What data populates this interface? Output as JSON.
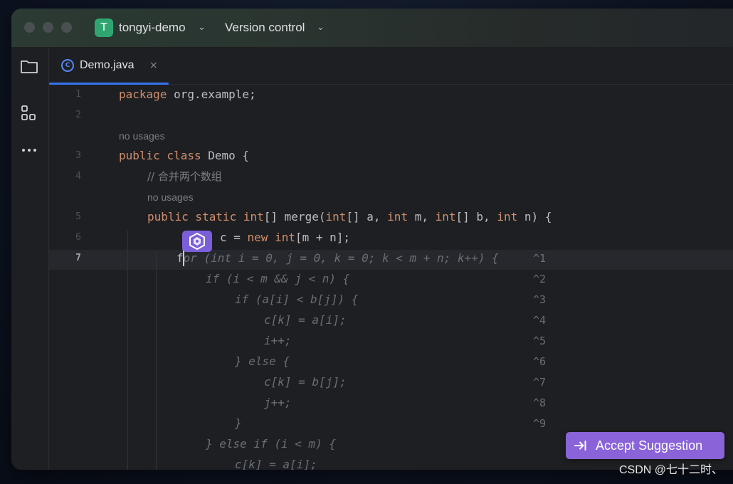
{
  "titlebar": {
    "project_initial": "T",
    "project_name": "tongyi-demo",
    "vcs_label": "Version control",
    "project_color": "#2fa672"
  },
  "sidebar": {
    "icons": [
      "folder-icon",
      "structure-icon",
      "more-icon"
    ]
  },
  "tabs": [
    {
      "label": "Demo.java",
      "icon": "java-class-icon",
      "close": "×",
      "active": true
    }
  ],
  "editor": {
    "line_numbers": [
      "1",
      "2",
      "3",
      "4",
      "5",
      "6",
      "7"
    ],
    "current_line": "7",
    "usage_hint": "no usages",
    "line1": {
      "kw": "package",
      "rest": " org.example;"
    },
    "line3": {
      "kw": "public class",
      "rest": " Demo {"
    },
    "line4_comment": "// 合并两个数组",
    "line5": {
      "kw1": "public static int",
      "t1": "[] merge(",
      "kw2": "int",
      "t2": "[] a, ",
      "kw3": "int",
      "t3": " m, ",
      "kw4": "int",
      "t4": "[] b, ",
      "kw5": "int",
      "t5": " n) {"
    },
    "line6": {
      "t1": "c = ",
      "kw1": "new",
      "kw2": " int",
      "t2": "[m + n];"
    },
    "line7_typed": "f",
    "suggestion_lines": [
      "or (int i = 0, j = 0, k = 0; k < m + n; k++) {",
      "if (i < m && j < n) {",
      "if (a[i] < b[j]) {",
      "c[k] = a[i];",
      "i++;",
      "} else {",
      "c[k] = b[j];",
      "j++;",
      "}",
      "} else if (i < m) {",
      "c[k] = a[i];"
    ],
    "suggestion_hints": [
      "^1",
      "^2",
      "^3",
      "^4",
      "^5",
      "^6",
      "^7",
      "^8",
      "^9"
    ]
  },
  "ai_badge_icon": "tongyi-lingma-icon",
  "accept_button": {
    "label": "Accept Suggestion",
    "icon": "tab-key-icon",
    "color": "#8a63d9"
  },
  "watermark": "CSDN @七十二时、",
  "colors": {
    "keyword": "#cf8e6d",
    "accent": "#3574f0",
    "background": "#1e1f22"
  }
}
